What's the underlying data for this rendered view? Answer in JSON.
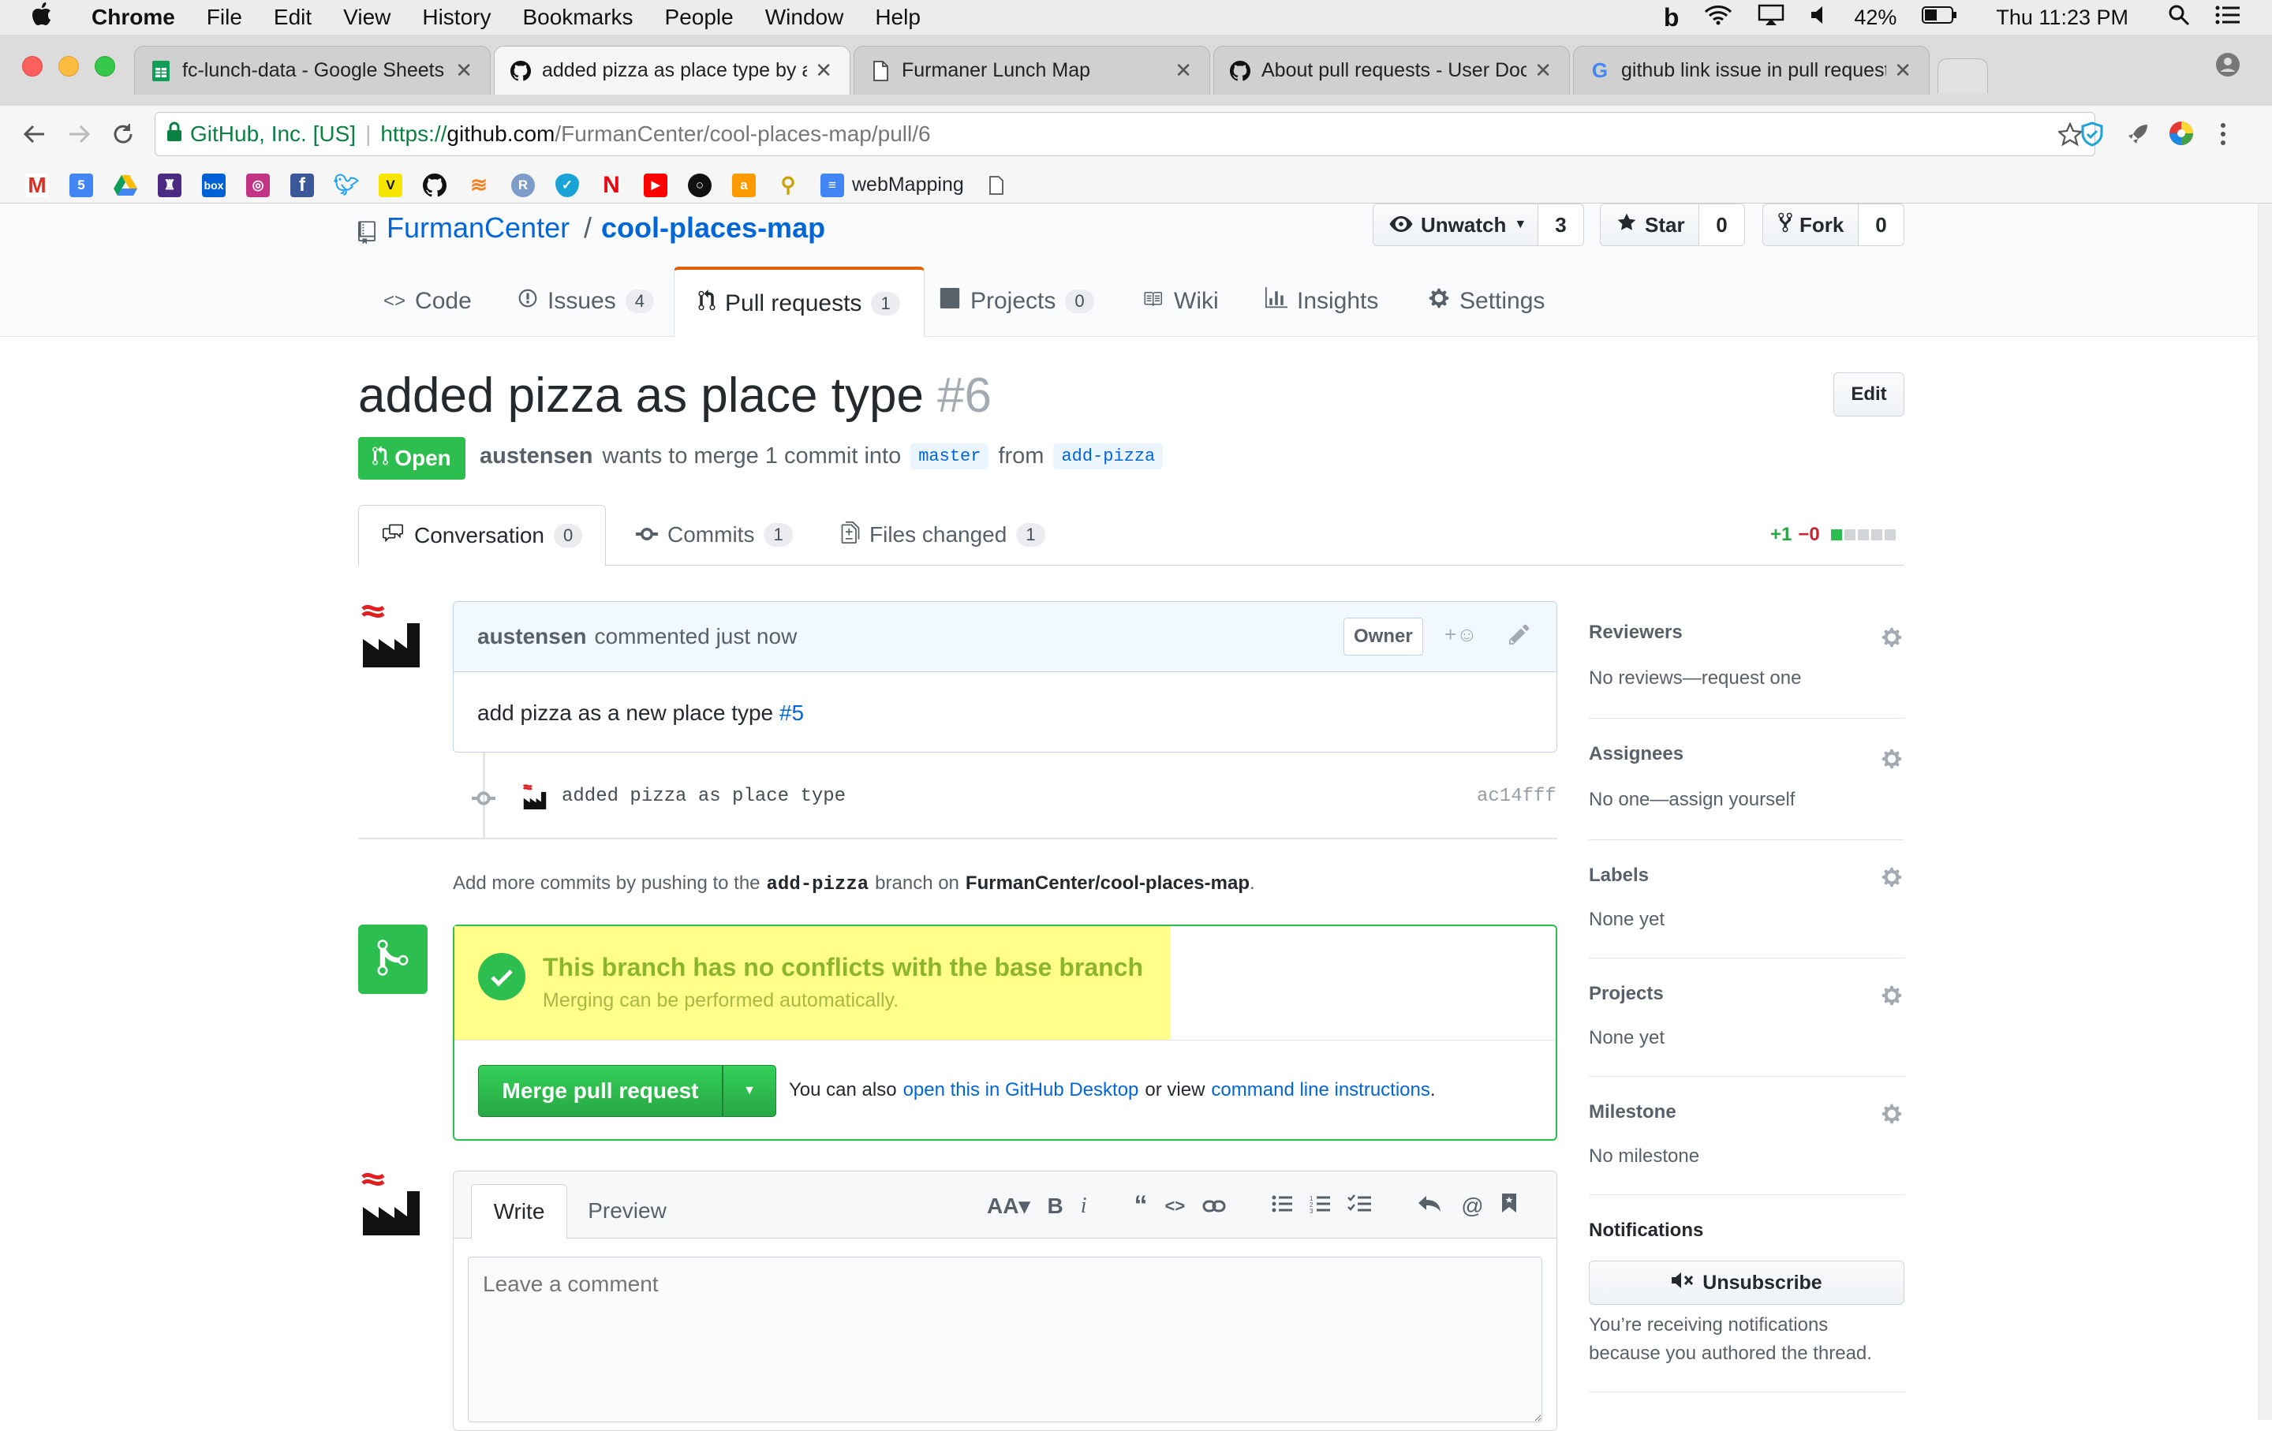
{
  "menubar": {
    "app": "Chrome",
    "items": [
      "File",
      "Edit",
      "View",
      "History",
      "Bookmarks",
      "People",
      "Window",
      "Help"
    ],
    "battery": "42%",
    "clock": "Thu 11:23 PM"
  },
  "tabs": [
    {
      "title": "fc-lunch-data - Google Sheets",
      "icon": "sheets-icon"
    },
    {
      "title": "added pizza as place type by a",
      "icon": "github-icon"
    },
    {
      "title": "Furmaner Lunch Map",
      "icon": "document-icon"
    },
    {
      "title": "About pull requests - User Doc",
      "icon": "github-icon"
    },
    {
      "title": "github link issue in pull request",
      "icon": "google-icon"
    }
  ],
  "address": {
    "secure_label": "GitHub, Inc. [US]",
    "url_scheme": "https://",
    "url_host": "github.com",
    "url_path": "/FurmanCenter/cool-places-map/pull/6"
  },
  "bookmarks": {
    "webmapping": "webMapping"
  },
  "repo": {
    "owner": "FurmanCenter",
    "separator": "/",
    "name": "cool-places-map",
    "unwatch_label": "Unwatch",
    "unwatch_count": "3",
    "star_label": "Star",
    "star_count": "0",
    "fork_label": "Fork",
    "fork_count": "0"
  },
  "reponav": {
    "code": "Code",
    "issues": "Issues",
    "issues_count": "4",
    "pulls": "Pull requests",
    "pulls_count": "1",
    "projects": "Projects",
    "projects_count": "0",
    "wiki": "Wiki",
    "insights": "Insights",
    "settings": "Settings"
  },
  "pr": {
    "title": "added pizza as place type",
    "number": "#6",
    "edit_label": "Edit",
    "state": "Open",
    "author": "austensen",
    "merge_text": "wants to merge 1 commit into",
    "base_branch": "master",
    "from_text": "from",
    "head_branch": "add-pizza"
  },
  "prtabs": {
    "conversation": "Conversation",
    "conversation_count": "0",
    "commits": "Commits",
    "commits_count": "1",
    "files": "Files changed",
    "files_count": "1",
    "additions": "+1",
    "deletions": "−0"
  },
  "comment": {
    "author": "austensen",
    "action": "commented just now",
    "owner_badge": "Owner",
    "body": "add pizza as a new place type",
    "issue_ref": "#5"
  },
  "commit": {
    "message": "added pizza as place type",
    "sha": "ac14fff"
  },
  "addmore": {
    "prefix": "Add more commits by pushing to the",
    "branch": "add-pizza",
    "middle": "branch on",
    "repo": "FurmanCenter/cool-places-map",
    "suffix": "."
  },
  "merge": {
    "status_title": "This branch has no conflicts with the base branch",
    "status_sub": "Merging can be performed automatically.",
    "button": "Merge pull request",
    "also_text": "You can also",
    "desktop_link": "open this in GitHub Desktop",
    "or_text": "or view",
    "cli_link": "command line instructions",
    "end": "."
  },
  "composer": {
    "write_tab": "Write",
    "preview_tab": "Preview",
    "placeholder": "Leave a comment"
  },
  "sidebar": {
    "reviewers_h": "Reviewers",
    "reviewers_t": "No reviews—request one",
    "assignees_h": "Assignees",
    "assignees_t": "No one—assign yourself",
    "labels_h": "Labels",
    "labels_t": "None yet",
    "projects_h": "Projects",
    "projects_t": "None yet",
    "milestone_h": "Milestone",
    "milestone_t": "No milestone",
    "notifications_h": "Notifications",
    "unsubscribe": "Unsubscribe",
    "notif_text_1": "You’re receiving notifications",
    "notif_text_2": "because you authored the thread."
  },
  "colors": {
    "green": "#2cbe4e",
    "merge_green": "#28a745",
    "link": "#0366d6",
    "highlight": "#ffff8a",
    "orange": "#e36209"
  }
}
